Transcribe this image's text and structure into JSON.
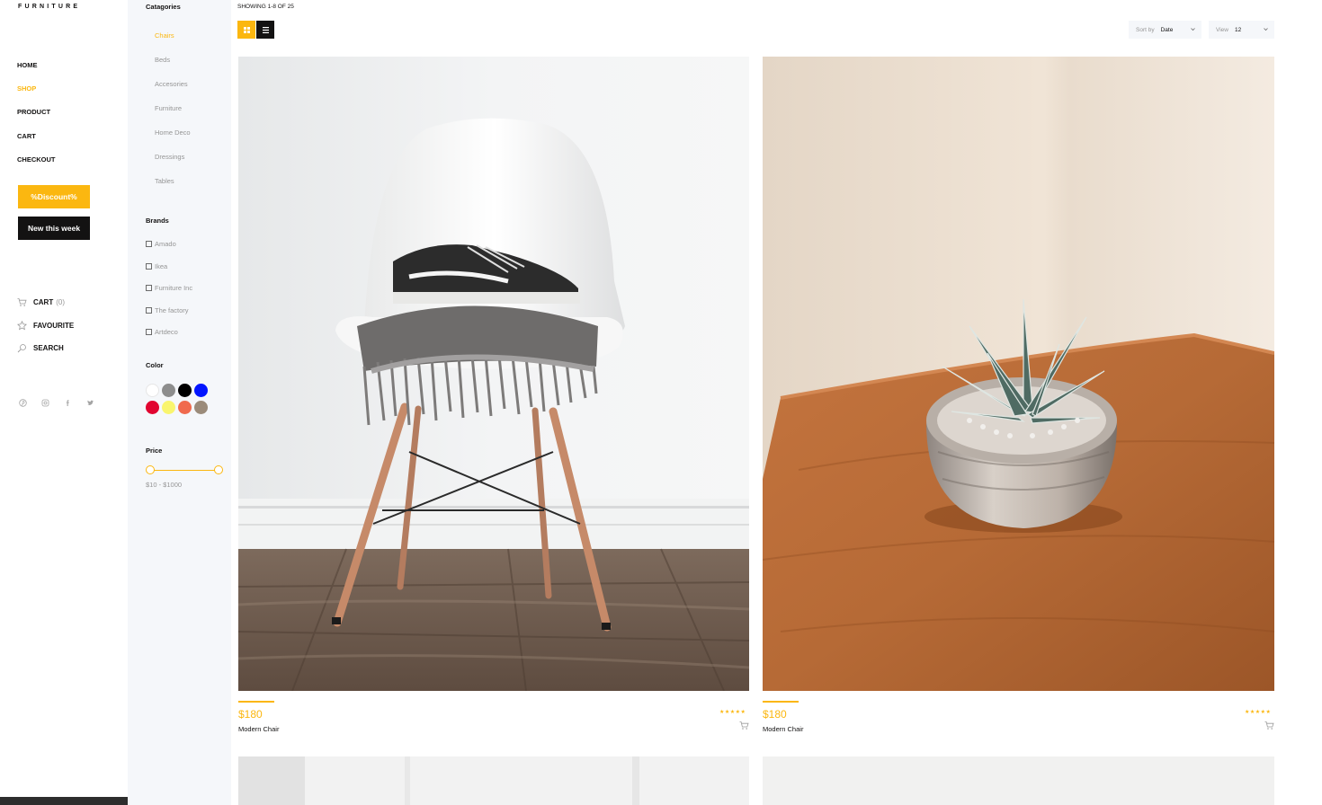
{
  "brand": {
    "logo": "FURNITURE"
  },
  "nav": {
    "items": [
      {
        "label": "HOME"
      },
      {
        "label": "SHOP"
      },
      {
        "label": "PRODUCT"
      },
      {
        "label": "CART"
      },
      {
        "label": "CHECKOUT"
      }
    ],
    "active_item": "SHOP"
  },
  "promo": {
    "discount_label": "%Discount%",
    "new_label": "New this week"
  },
  "user_nav": {
    "cart_label": "CART",
    "cart_count": "(0)",
    "favourite_label": "FAVOURITE",
    "search_label": "SEARCH"
  },
  "social_icons": [
    "pinterest-icon",
    "instagram-icon",
    "facebook-icon",
    "twitter-icon"
  ],
  "filters": {
    "categories_title": "Catagories",
    "categories": [
      "Chairs",
      "Beds",
      "Accesories",
      "Furniture",
      "Home Deco",
      "Dressings",
      "Tables"
    ],
    "active_category": "Chairs",
    "brands_title": "Brands",
    "brands": [
      "Amado",
      "Ikea",
      "Furniture Inc",
      "The factory",
      "Artdeco"
    ],
    "color_title": "Color",
    "colors": [
      "#ffffff",
      "#8d8d8d",
      "#000000",
      "#0315ff",
      "#e10530",
      "#f9f56e",
      "#f06a4d",
      "#9b8b7a"
    ],
    "price_title": "Price",
    "price_range": "$10 - $1000",
    "price_min_fraction": 0,
    "price_max_fraction": 1
  },
  "toolbar": {
    "showing": "SHOWING 1-8 OF 25",
    "sort_label": "Sort by",
    "sort_value": "Date",
    "view_label": "View",
    "view_value": "12"
  },
  "products": [
    {
      "price": "$180",
      "name": "Modern Chair",
      "rating": 5,
      "stars": "★★★★★"
    },
    {
      "price": "$180",
      "name": "Modern Chair",
      "rating": 5,
      "stars": "★★★★★"
    }
  ],
  "accent_color": "#fbb710"
}
